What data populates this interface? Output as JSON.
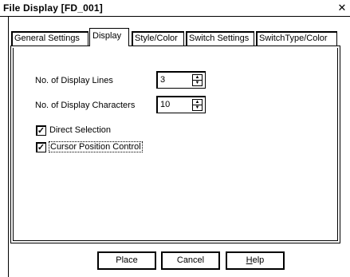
{
  "window": {
    "title": "File Display [FD_001]",
    "close_icon": "close-icon"
  },
  "tabs": [
    {
      "label": "General Settings",
      "active": false
    },
    {
      "label": "Display",
      "active": true
    },
    {
      "label": "Style/Color",
      "active": false
    },
    {
      "label": "Switch Settings",
      "active": false
    },
    {
      "label": "SwitchType/Color",
      "active": false
    }
  ],
  "display": {
    "lines_label": "No. of Display Lines",
    "lines_value": "3",
    "chars_label": "No. of Display Characters",
    "chars_value": "10",
    "direct_selection_label": "Direct Selection",
    "direct_selection_checked": true,
    "cursor_position_label": "Cursor Position Control",
    "cursor_position_checked": true
  },
  "buttons": {
    "place": "Place",
    "cancel": "Cancel",
    "help_prefix": "",
    "help_hotkey": "H",
    "help_suffix": "elp"
  }
}
